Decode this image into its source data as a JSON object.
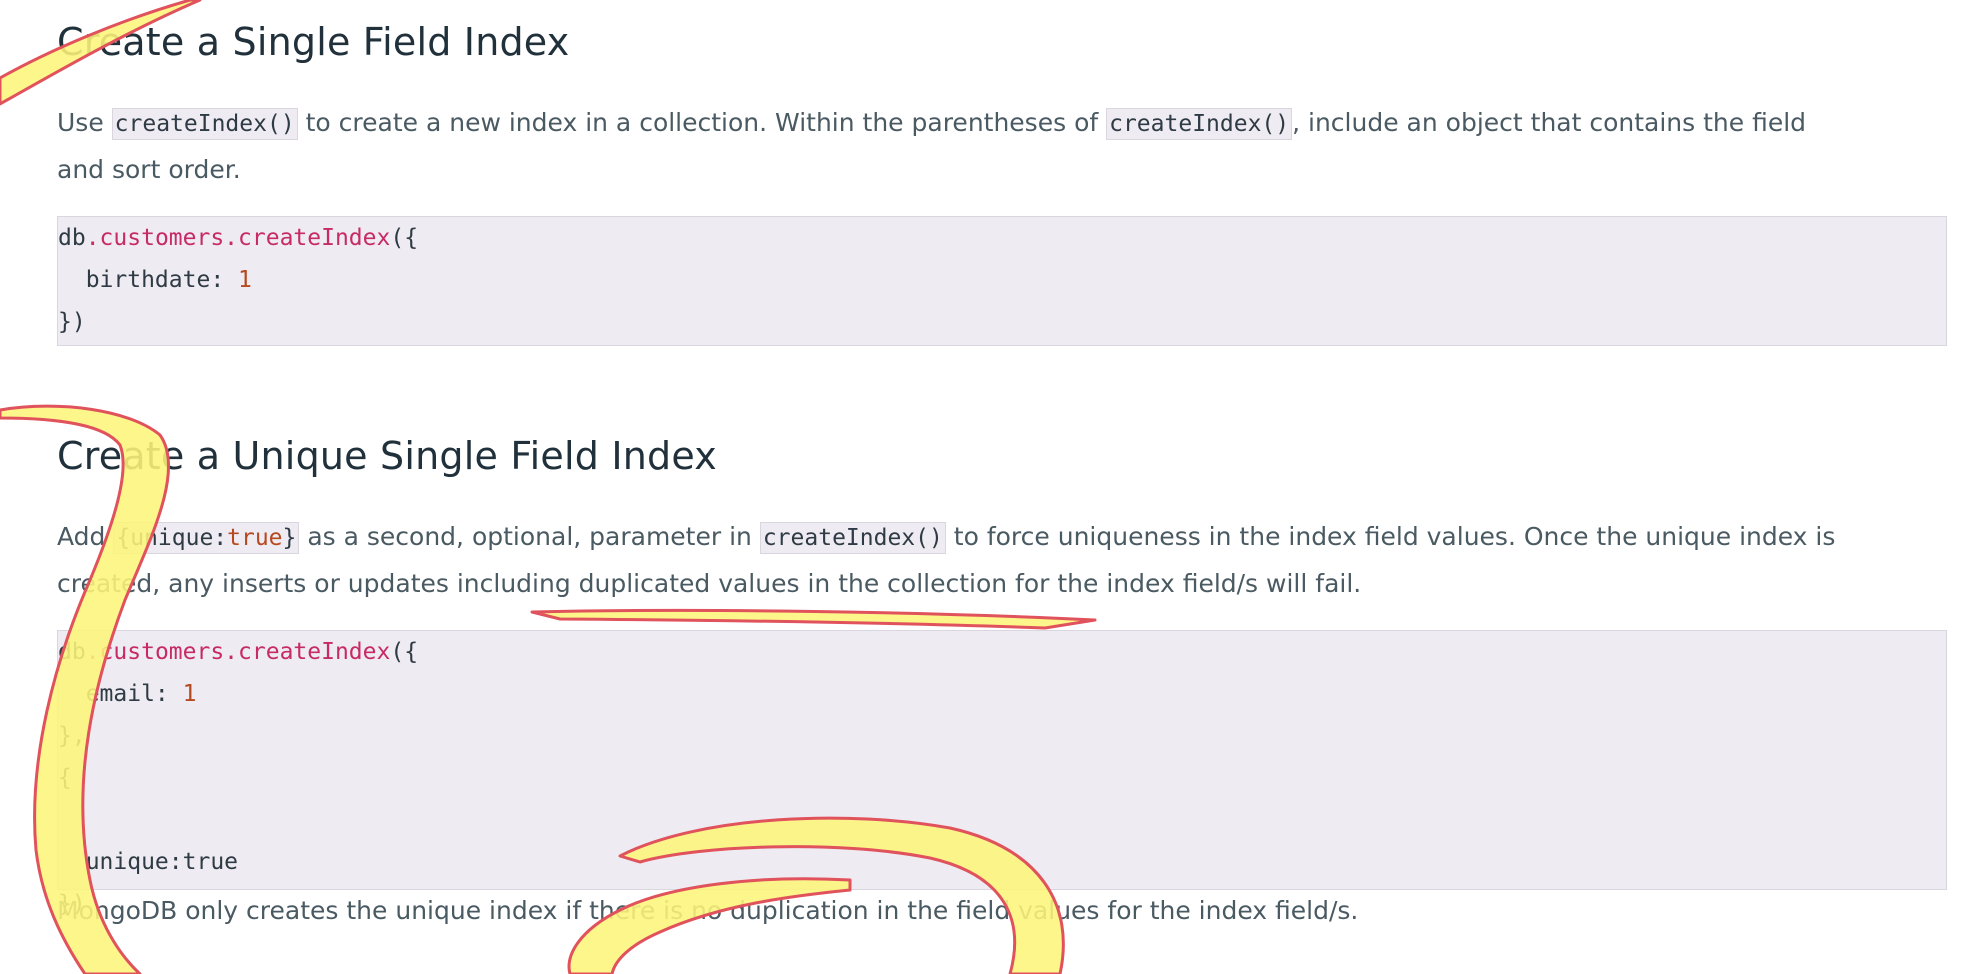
{
  "section1": {
    "heading": "Create a Single Field Index",
    "p_before": "Use ",
    "p_code1": "createIndex()",
    "p_mid": " to create a new index in a collection. Within the parentheses of ",
    "p_code2": "createIndex()",
    "p_after": ", include an object that contains the field",
    "p_line2": "and sort order.",
    "code": {
      "l1_obj": "db",
      "l1_method": ".customers.createIndex",
      "l1_tail": "({",
      "l2_key": "  birthdate: ",
      "l2_num": "1",
      "l3": "})"
    }
  },
  "section2": {
    "heading": "Create a Unique Single Field Index",
    "p_before": "Add ",
    "p_code1_a": "{unique:",
    "p_code1_b": "true",
    "p_code1_c": "}",
    "p_mid": " as a second, optional, parameter in ",
    "p_code2": "createIndex()",
    "p_after": " to force uniqueness in the index field values. Once the unique index is",
    "p_line2": "created, any inserts or updates including duplicated values in the collection for the index field/s will fail.",
    "code": {
      "l1_obj": "db",
      "l1_method": ".customers.createIndex",
      "l1_tail": "({",
      "l2_key": "  email: ",
      "l2_num": "1",
      "l3": "},",
      "l4": "{",
      "l5": "",
      "l6": "  unique:true",
      "l7": "})"
    },
    "note": "MongoDB only creates the unique index if there is no duplication in the field values for the index field/s."
  },
  "colors": {
    "heading": "#21313c",
    "body_text": "#4a5a62",
    "code_background": "#efebf2",
    "code_method": "#c62a67",
    "code_number": "#b5491f",
    "highlighter_fill": "#fdf57a",
    "highlighter_stroke": "#e0525c"
  }
}
